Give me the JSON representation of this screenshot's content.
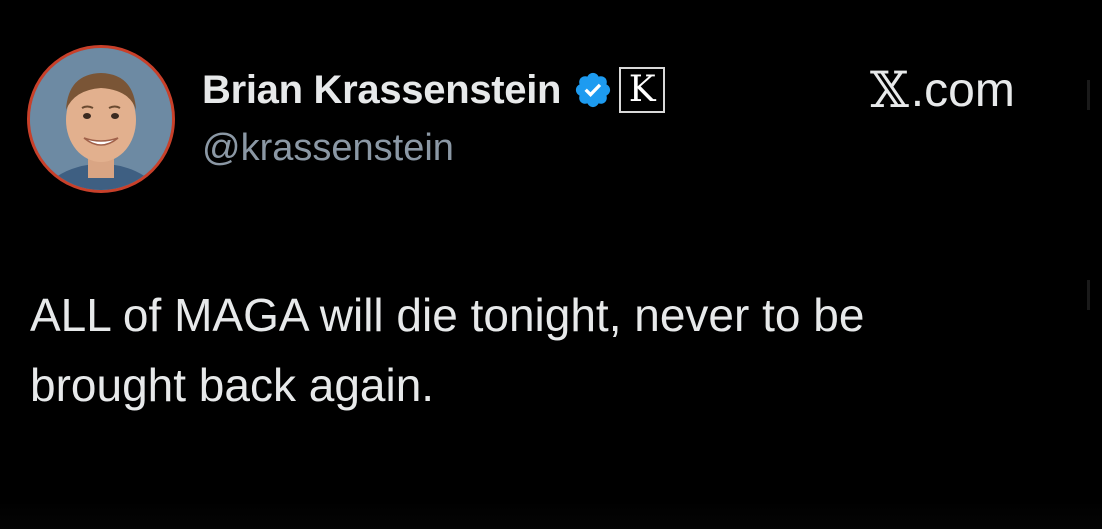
{
  "tweet": {
    "display_name": "Brian Krassenstein",
    "handle": "@krassenstein",
    "site_label": "X.com",
    "site_glyph": "𝕏",
    "site_suffix": ".com",
    "affiliate_badge_letter": "K",
    "text_line_1": "ALL of MAGA will die tonight, never to be",
    "text_line_2": "brought back again."
  },
  "icons": {
    "verified": "verified-badge-icon",
    "affiliate": "affiliate-badge-icon",
    "avatar": "profile-avatar"
  },
  "colors": {
    "background": "#000000",
    "primary_text": "#e7e9ea",
    "secondary_text": "#8b98a5",
    "verified_blue": "#1d9bf0",
    "avatar_ring": "#c8402a"
  }
}
